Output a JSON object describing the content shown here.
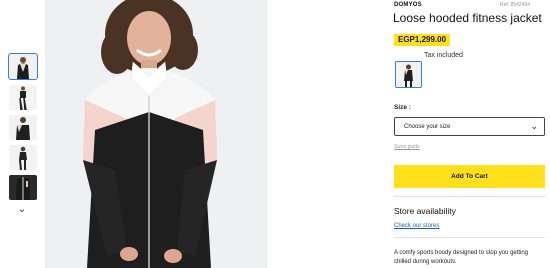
{
  "product": {
    "brand": "DOMYOS",
    "ref": "Ref. 8542494",
    "title": "Loose hooded fitness jacket",
    "price": "EGP1,299.00",
    "tax_note": "Tax included"
  },
  "size": {
    "label": "Size :",
    "placeholder": "Choose your size",
    "guide_link": "Sizes guide"
  },
  "actions": {
    "add_to_cart": "Add To Cart"
  },
  "store": {
    "heading": "Store availability",
    "link": "Check our stores"
  },
  "description": "A comfy sports hoody designed to stop you getting chilled during workouts.",
  "colors": {
    "accent_yellow": "#ffe01b",
    "selected_border": "#3a7be0",
    "link_blue": "#1f5fbf"
  },
  "icons": {
    "thumbnails_down": "chevron-down-icon",
    "select_arrow": "chevron-down-icon"
  }
}
